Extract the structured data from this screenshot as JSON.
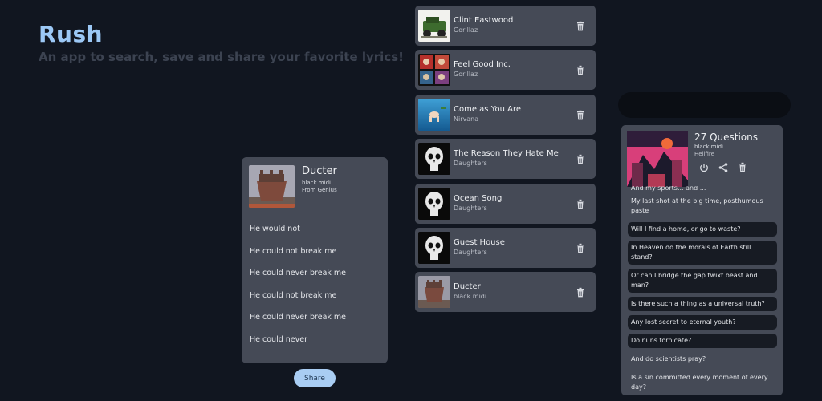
{
  "hero": {
    "title": "Rush",
    "subtitle": "An app to search, save and share your favorite lyrics!"
  },
  "songs": [
    {
      "title": "Clint Eastwood",
      "artist": "Gorillaz"
    },
    {
      "title": "Feel Good Inc.",
      "artist": "Gorillaz"
    },
    {
      "title": "Come as You Are",
      "artist": "Nirvana"
    },
    {
      "title": "The Reason They Hate Me",
      "artist": "Daughters"
    },
    {
      "title": "Ocean Song",
      "artist": "Daughters"
    },
    {
      "title": "Guest House",
      "artist": "Daughters"
    },
    {
      "title": "Ducter",
      "artist": "black midi"
    }
  ],
  "lyrics_card": {
    "title": "Ducter",
    "artist": "black midi",
    "source": "From Genius",
    "lines": [
      "He would not",
      "He could not break me",
      "He could never break me",
      "He could not break me",
      "He could never break me",
      "He could never"
    ]
  },
  "share_button": {
    "label": "Share"
  },
  "detail_panel": {
    "title": "27 Questions",
    "artist": "black midi",
    "album": "Hellfire",
    "cut_line": "And my sports... and ...",
    "lines": [
      {
        "text": "My last shot at the big time, posthumous paste",
        "highlight": false
      },
      {
        "text": "Will I find a home, or go to waste?",
        "highlight": true
      },
      {
        "text": "In Heaven do the morals of Earth still stand?",
        "highlight": true
      },
      {
        "text": "Or can I bridge the gap twixt beast and man?",
        "highlight": true
      },
      {
        "text": "Is there such a thing as a universal truth?",
        "highlight": true
      },
      {
        "text": "Any lost secret to eternal youth?",
        "highlight": true
      },
      {
        "text": "Do nuns fornicate?",
        "highlight": true
      },
      {
        "text": "And do scientists pray?",
        "highlight": false
      },
      {
        "text": "Is a sin committed every moment of every day?",
        "highlight": false
      }
    ]
  }
}
